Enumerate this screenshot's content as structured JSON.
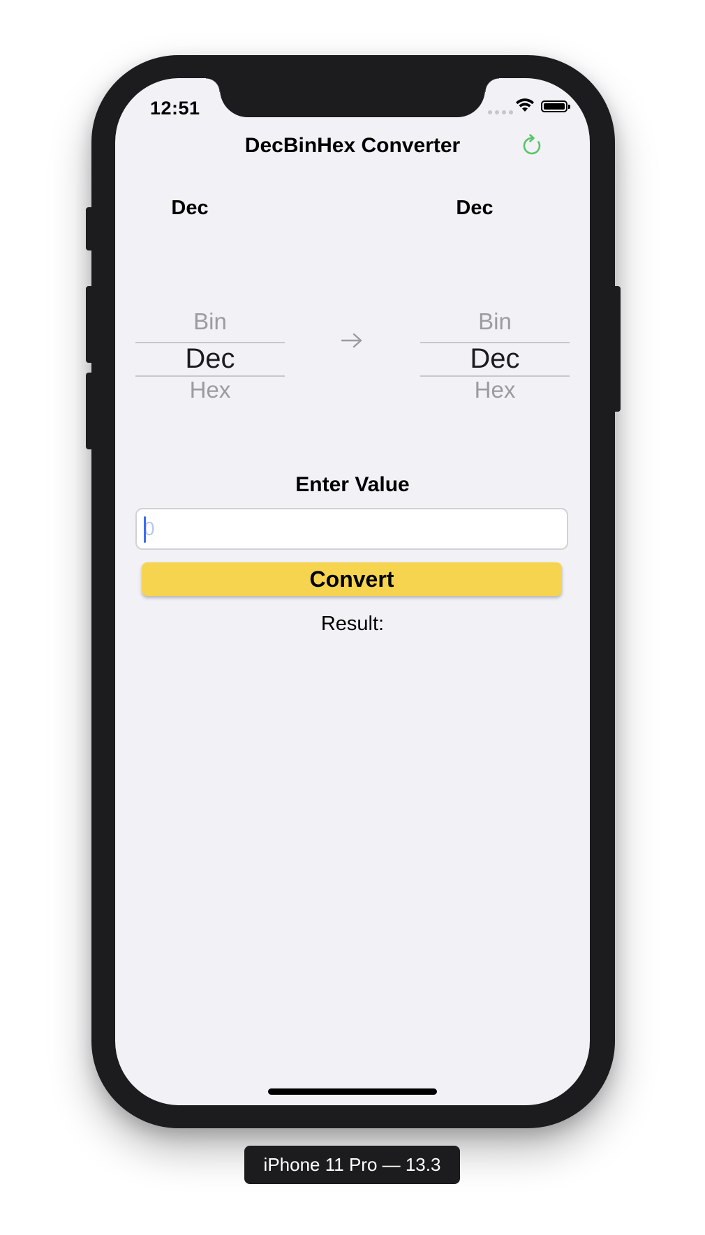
{
  "status_bar": {
    "time": "12:51"
  },
  "nav": {
    "title": "DecBinHex Converter",
    "refresh_icon": "refresh-icon"
  },
  "from_column": {
    "label": "Dec",
    "picker": {
      "above": "Bin",
      "selected": "Dec",
      "below": "Hex"
    }
  },
  "to_column": {
    "label": "Dec",
    "picker": {
      "above": "Bin",
      "selected": "Dec",
      "below": "Hex"
    }
  },
  "arrow_icon": "arrow-right-icon",
  "form": {
    "enter_label": "Enter Value",
    "input_value": "",
    "input_placeholder": "0",
    "convert_label": "Convert",
    "result_label": "Result:"
  },
  "device": {
    "label": "iPhone 11 Pro — 13.3"
  },
  "colors": {
    "accent_yellow": "#f7d44f",
    "refresh_green": "#5ac466",
    "background": "#f2f1f6"
  }
}
